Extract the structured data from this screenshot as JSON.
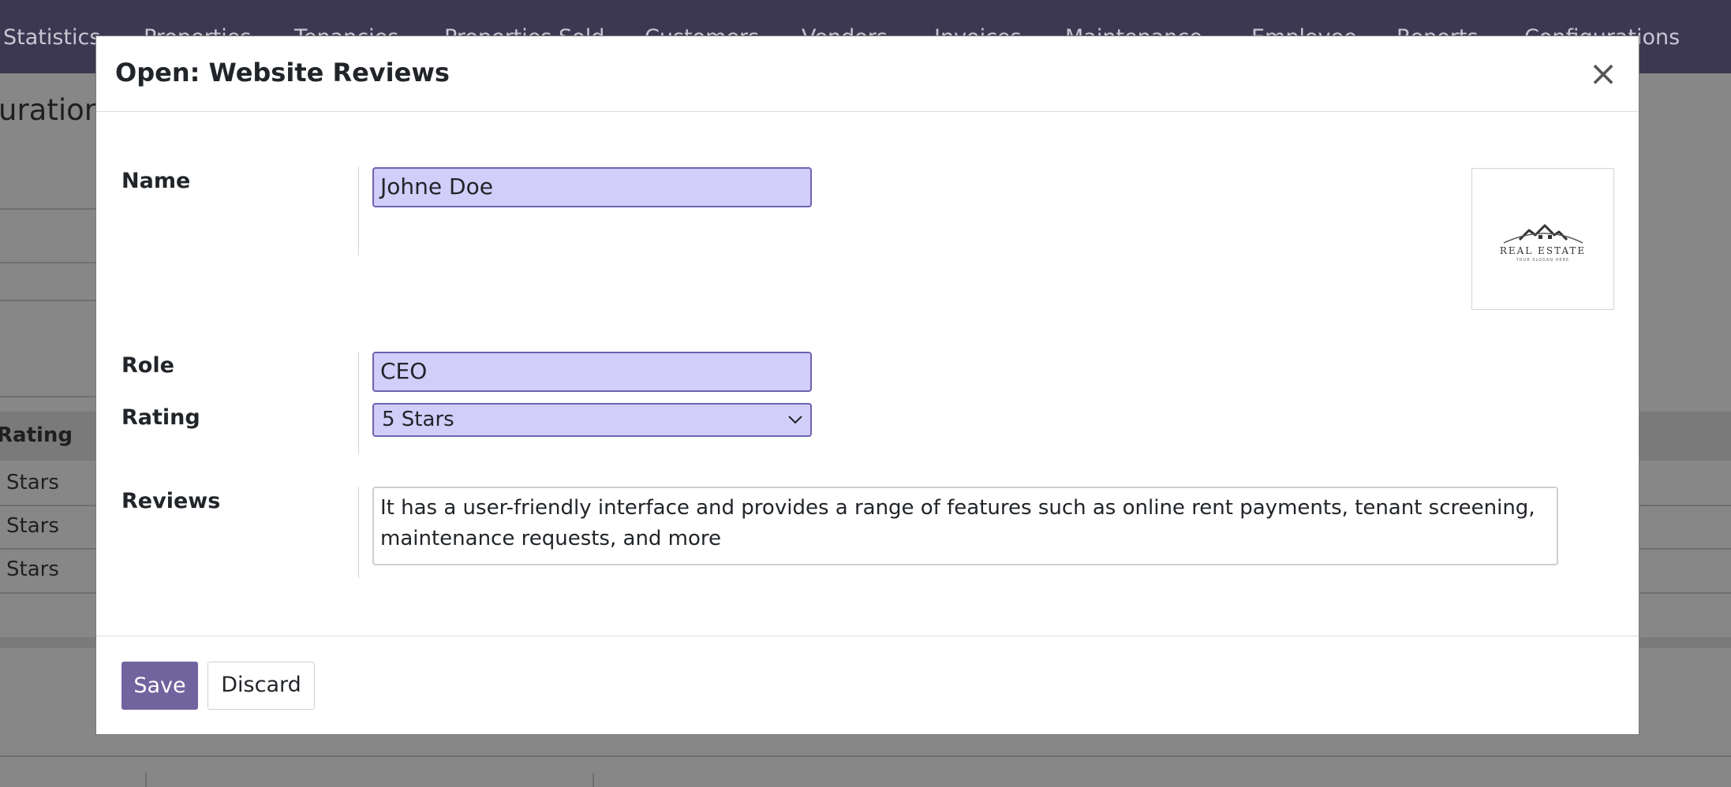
{
  "background": {
    "nav_items": [
      "Statistics",
      "Properties",
      "Tenancies",
      "Properties Sold",
      "Customers",
      "Vendors",
      "Invoices",
      "Maintenance",
      "Employee",
      "Reports",
      "Configurations"
    ],
    "breadcrumb": "uration",
    "table_header": "Rating",
    "table_rows": [
      "Stars",
      "Stars",
      "Stars"
    ]
  },
  "modal": {
    "title": "Open: Website Reviews",
    "close_glyph": "×",
    "fields": {
      "name_label": "Name",
      "name_value": "Johne Doe",
      "role_label": "Role",
      "role_value": "CEO",
      "rating_label": "Rating",
      "rating_value": "5 Stars",
      "reviews_label": "Reviews",
      "reviews_value": "It has a user-friendly interface and provides a range of features such as online rent payments, tenant screening, maintenance requests, and more"
    },
    "image": {
      "logo_text": "REAL ESTATE",
      "logo_subtext": "YOUR SLOGAN HERE"
    },
    "footer": {
      "save_label": "Save",
      "discard_label": "Discard"
    }
  },
  "colors": {
    "navbar": "#3d3851",
    "primary_button": "#71639e",
    "required_field_bg": "#d1cefa",
    "required_field_border": "#6e63b0"
  }
}
